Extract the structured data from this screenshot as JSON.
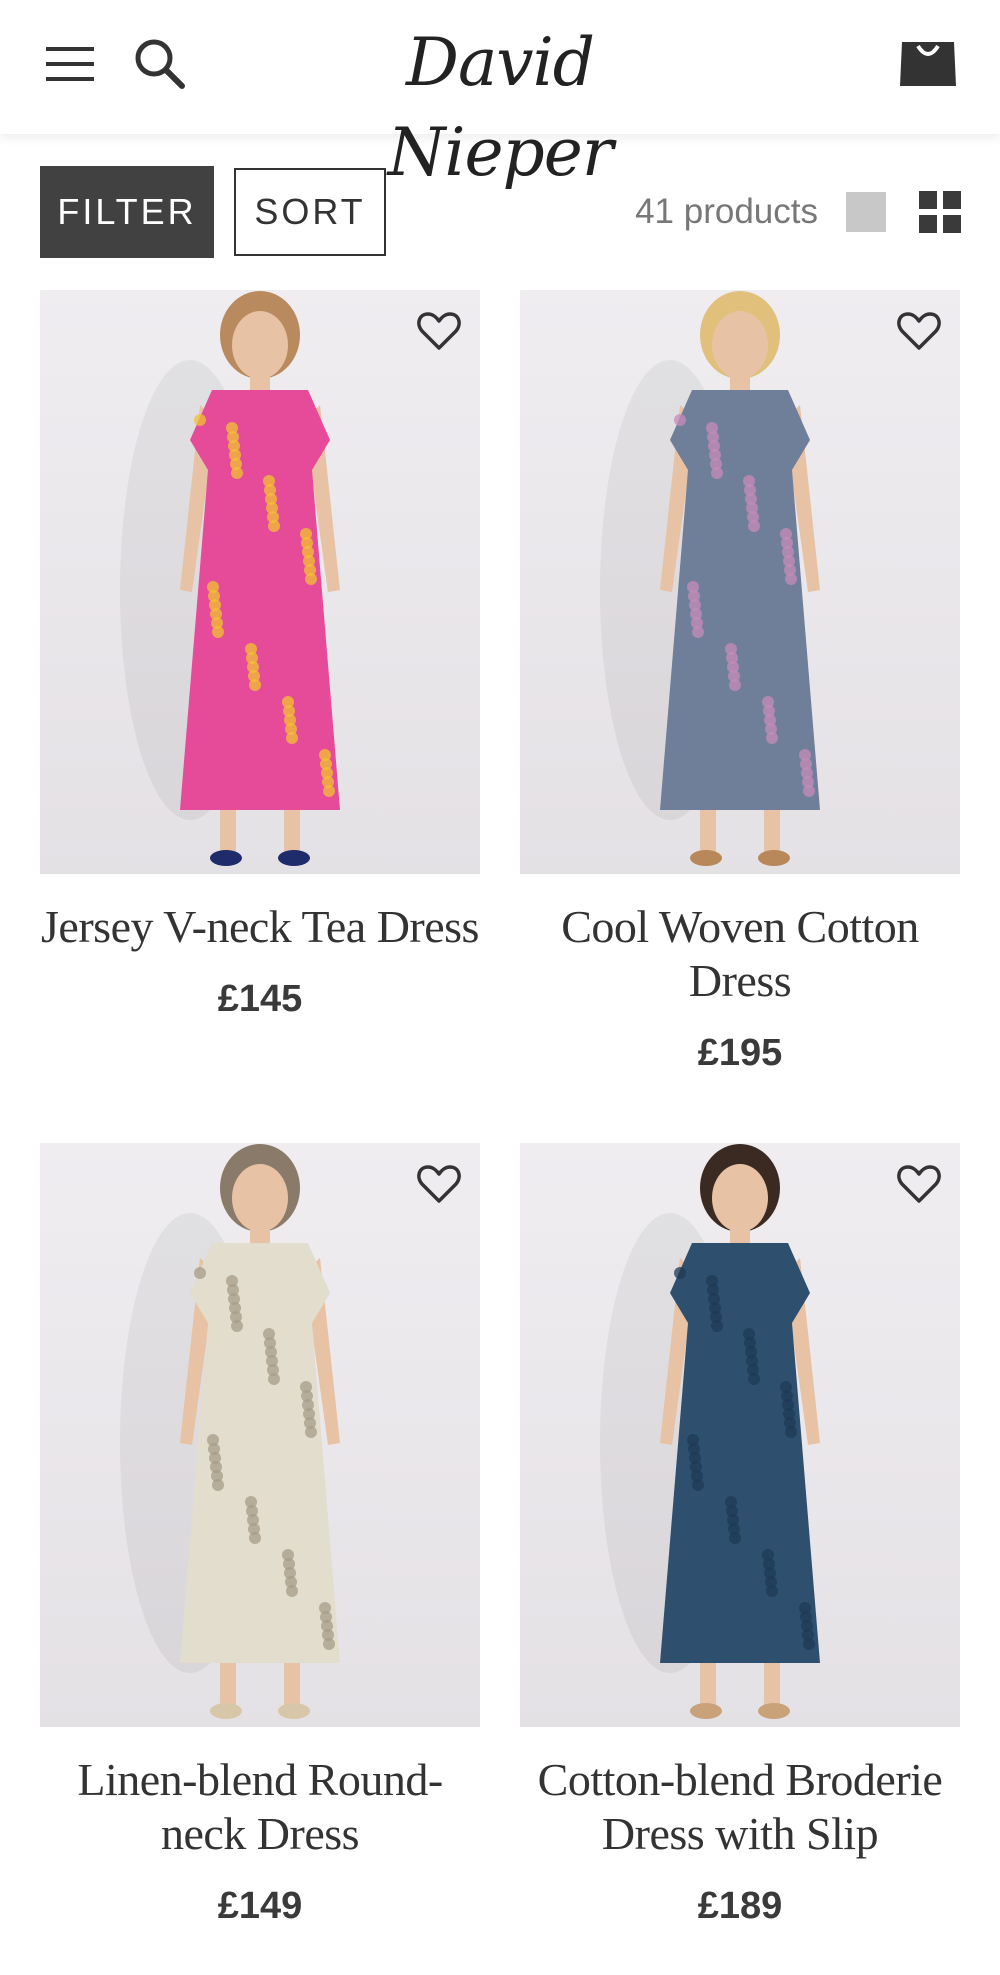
{
  "header": {
    "logo_text": "David Nieper",
    "menu_icon": "hamburger-menu-icon",
    "search_icon": "search-icon",
    "bag_icon": "shopping-bag-icon"
  },
  "toolbar": {
    "filter_label": "FILTER",
    "sort_label": "SORT",
    "product_count": "41 products",
    "view_single_icon": "single-column-view-icon",
    "view_grid_icon": "grid-view-icon"
  },
  "products": [
    {
      "title": "Jersey V-neck Tea Dress",
      "price": "£145",
      "dress_color": "#e64b9a",
      "accent_color": "#f2c230"
    },
    {
      "title": "Cool Woven Cotton Dress",
      "price": "£195",
      "dress_color": "#6f7f99",
      "accent_color": "#c78bb8"
    },
    {
      "title": "Linen-blend Round-neck Dress",
      "price": "£149",
      "dress_color": "#e3ddcd",
      "accent_color": "#a59c88"
    },
    {
      "title": "Cotton-blend Broderie Dress with Slip",
      "price": "£189",
      "dress_color": "#2f4f6f",
      "accent_color": "#1f3a55"
    }
  ],
  "colors": {
    "filter_bg": "#414141",
    "text_dark": "#333333",
    "image_bg": "#ebe8ec"
  }
}
